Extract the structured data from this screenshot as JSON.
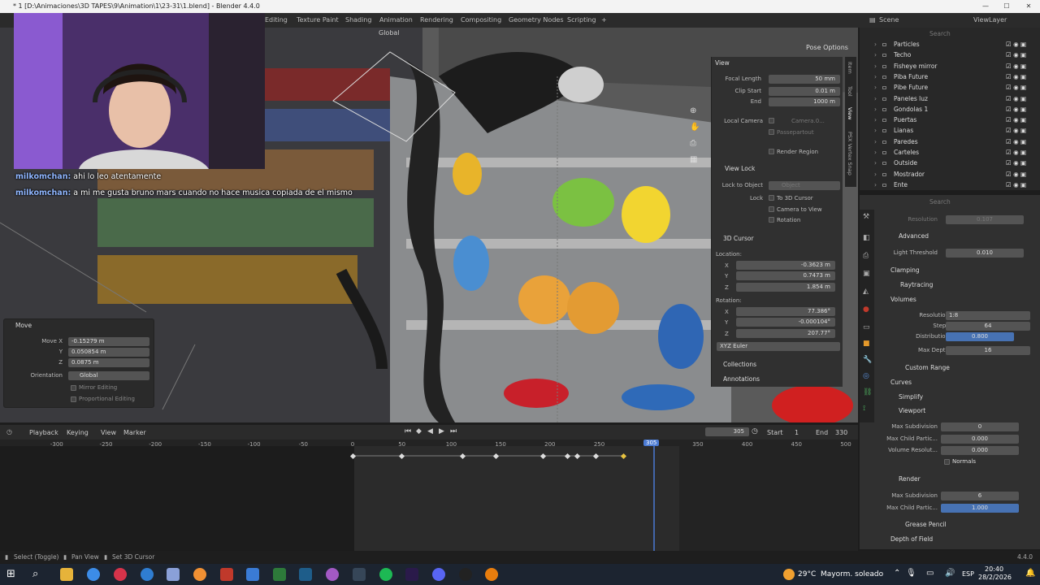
{
  "window": {
    "title": "* 1 [D:\\Animaciones\\3D TAPES\\9\\Animation\\1\\23-31\\1.blend] - Blender 4.4.0",
    "minimize": "—",
    "maximize": "☐",
    "close": "✕"
  },
  "workspaces": [
    "Editing",
    "Texture Paint",
    "Shading",
    "Animation",
    "Rendering",
    "Compositing",
    "Geometry Nodes",
    "Scripting",
    "+"
  ],
  "scene": {
    "scene_label": "Scene",
    "view_layer_label": "ViewLayer"
  },
  "viewport_header": {
    "orientation": "Global",
    "pose_options": "Pose Options"
  },
  "chat": [
    {
      "user": "milkomchan:",
      "text": " ahi lo leo atentamente"
    },
    {
      "user": "milkomchan:",
      "text": " a mi me gusta bruno mars cuando no hace musica copiada de el mismo"
    }
  ],
  "npanel": {
    "view_header": "View",
    "focal_length_label": "Focal Length",
    "focal_length": "50 mm",
    "clip_start_label": "Clip Start",
    "clip_start": "0.01 m",
    "end_label": "End",
    "end": "1000 m",
    "local_camera_label": "Local Camera",
    "local_camera_value": "Camera.0...",
    "passepartout": "Passepartout",
    "render_region": "Render Region",
    "view_lock_header": "View Lock",
    "lock_to_object_label": "Lock to Object",
    "lock_to_object_placeholder": "Object",
    "lock_label": "Lock",
    "to_3d_cursor": "To 3D Cursor",
    "camera_to_view": "Camera to View",
    "rotation_check": "Rotation",
    "cursor_header": "3D Cursor",
    "location_label": "Location:",
    "loc_x": "-0.3623 m",
    "loc_y": "0.7473 m",
    "loc_z": "1.854 m",
    "rotation_label": "Rotation:",
    "rot_x": "77.386°",
    "rot_y": "-0.000104°",
    "rot_z": "207.77°",
    "rotation_mode": "XYZ Euler",
    "collections_header": "Collections",
    "annotations_header": "Annotations",
    "x": "X",
    "y": "Y",
    "z": "Z"
  },
  "side_tabs": [
    "Item",
    "Tool",
    "View",
    "PSX Vertex Snap"
  ],
  "move_panel": {
    "header": "Move",
    "move_x_label": "Move X",
    "move_x": "-0.15279 m",
    "y_label": "Y",
    "y": "0.050854 m",
    "z_label": "Z",
    "z": "0.0875 m",
    "orientation_label": "Orientation",
    "orientation": "Global",
    "mirror_editing": "Mirror Editing",
    "proportional_editing": "Proportional Editing"
  },
  "outliner": {
    "search_placeholder": "Search",
    "items": [
      "Particles",
      "Techo",
      "Fisheye mirror",
      "Piba Future",
      "Pibe Future",
      "Paneles luz",
      "Gondolas 1",
      "Puertas",
      "Lianas",
      "Paredes",
      "Carteles",
      "Outside",
      "Mostrador",
      "Ente"
    ]
  },
  "properties": {
    "search_placeholder": "Search",
    "resolution_label": "Resolution",
    "resolution_top": "0.107",
    "advanced_header": "Advanced",
    "light_threshold_label": "Light Threshold",
    "light_threshold": "0.010",
    "clamping_header": "Clamping",
    "raytracing_header": "Raytracing",
    "volumes_header": "Volumes",
    "vol_resolution_label": "Resolution",
    "vol_resolution": "1:8",
    "steps_label": "Steps",
    "steps": "64",
    "distribution_label": "Distribution",
    "distribution": "0.800",
    "max_depth_label": "Max Depth",
    "max_depth": "16",
    "custom_range": "Custom Range",
    "curves_header": "Curves",
    "simplify_header": "Simplify",
    "viewport_header": "Viewport",
    "max_subdivision_label": "Max Subdivision",
    "max_subdivision": "0",
    "max_child_label": "Max Child Partic...",
    "max_child": "0.000",
    "volume_resolution_label": "Volume Resolut...",
    "volume_resolution": "0.000",
    "normals": "Normals",
    "render_header": "Render",
    "render_max_subdivision_label": "Max Subdivision",
    "render_max_subdivision": "6",
    "render_max_child_label": "Max Child Partic...",
    "render_max_child": "1.000",
    "grease_pencil": "Grease Pencil",
    "depth_of_field": "Depth of Field"
  },
  "timeline": {
    "menus": [
      "Playback",
      "Keying",
      "View",
      "Marker"
    ],
    "current_frame": "305",
    "start_label": "Start",
    "start": "1",
    "end_label": "End",
    "end": "330",
    "ticks": [
      "-300",
      "-250",
      "-200",
      "-150",
      "-100",
      "-50",
      "0",
      "50",
      "100",
      "150",
      "200",
      "250",
      "350",
      "400",
      "450",
      "500"
    ],
    "keyframes": [
      0,
      50,
      112,
      145,
      193,
      218,
      228,
      247,
      275
    ]
  },
  "statusbar": {
    "select": "Select (Toggle)",
    "pan": "Pan View",
    "cursor": "Set 3D Cursor",
    "version": "4.4.0"
  },
  "taskbar": {
    "weather_temp": "29°C",
    "weather_text": "Mayorm. soleado",
    "lang": "ESP",
    "time": "20:40",
    "date": "28/2/2026"
  }
}
